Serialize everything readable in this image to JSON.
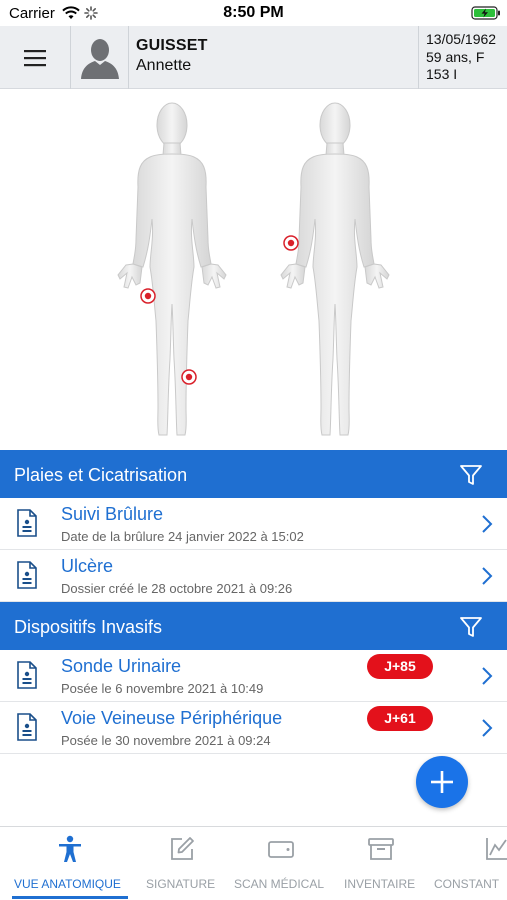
{
  "status_bar": {
    "carrier": "Carrier",
    "time": "8:50 PM"
  },
  "patient": {
    "last_name": "GUISSET",
    "first_name": "Annette",
    "birth_date": "13/05/1962",
    "age_sex": "59 ans, F",
    "room": "153 I"
  },
  "body_map": {
    "markers": [
      {
        "view": "front",
        "location": "right thigh"
      },
      {
        "view": "front",
        "location": "right knee"
      },
      {
        "view": "back",
        "location": "left wrist"
      }
    ]
  },
  "sections": [
    {
      "title": "Plaies et Cicatrisation",
      "items": [
        {
          "title": "Suivi Brûlure",
          "subtitle": "Date de la brûlure 24 janvier 2022 à 15:02"
        },
        {
          "title": "Ulcère",
          "subtitle": "Dossier créé le 28 octobre 2021 à 09:26"
        }
      ]
    },
    {
      "title": "Dispositifs Invasifs",
      "items": [
        {
          "title": "Sonde Urinaire",
          "subtitle": "Posée le 6 novembre 2021 à 10:49",
          "badge": "J+85"
        },
        {
          "title": "Voie Veineuse Périphérique",
          "subtitle": "Posée le 30 novembre 2021 à 09:24",
          "badge": "J+61"
        }
      ]
    }
  ],
  "tabs": [
    {
      "label": "VUE ANATOMIQUE",
      "icon": "person-icon",
      "active": true
    },
    {
      "label": "SIGNATURE",
      "icon": "pencil-square-icon",
      "active": false
    },
    {
      "label": "SCAN MÉDICAL",
      "icon": "card-scan-icon",
      "active": false
    },
    {
      "label": "INVENTAIRE",
      "icon": "archive-box-icon",
      "active": false
    },
    {
      "label": "CONSTANT",
      "icon": "chart-icon",
      "active": false
    }
  ],
  "colors": {
    "accent": "#1f6fd1",
    "badge": "#e3111b",
    "marker": "#d9202a",
    "header_bg": "#eceef1"
  }
}
